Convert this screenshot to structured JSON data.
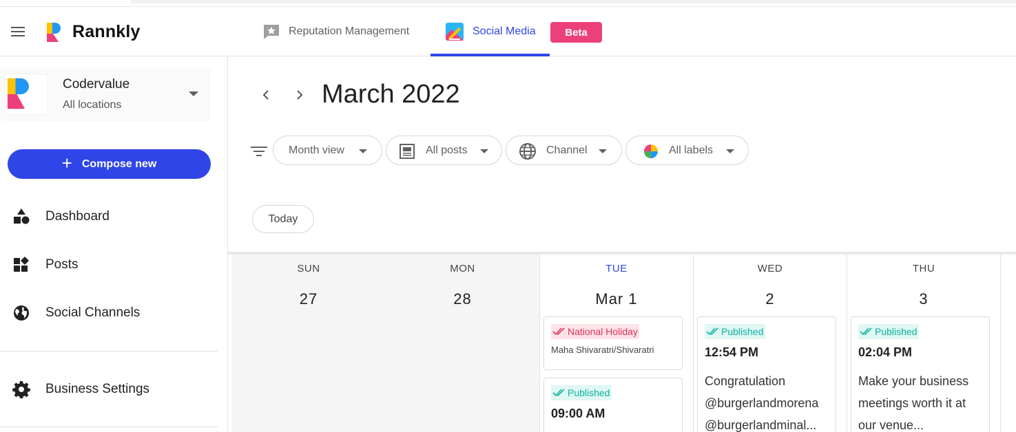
{
  "header": {
    "brand": "Rannkly",
    "tabs": [
      {
        "label": "Reputation Management",
        "icon": "star-flag-icon",
        "active": false
      },
      {
        "label": "Social Media",
        "icon": "social-media-icon",
        "active": true
      }
    ],
    "beta_label": "Beta"
  },
  "sidebar": {
    "account": {
      "name": "Codervalue",
      "sub": "All locations"
    },
    "compose_label": "Compose new",
    "items": [
      {
        "label": "Dashboard",
        "icon": "shapes-icon"
      },
      {
        "label": "Posts",
        "icon": "widgets-icon"
      },
      {
        "label": "Social Channels",
        "icon": "globe-icon"
      },
      {
        "label": "Business Settings",
        "icon": "gear-icon"
      }
    ]
  },
  "calendar": {
    "title": "March 2022",
    "filters": [
      {
        "label": "Month view",
        "icon": ""
      },
      {
        "label": "All posts",
        "icon": "article-icon"
      },
      {
        "label": "Channel",
        "icon": "globe-icon"
      },
      {
        "label": "All labels",
        "icon": "color-wheel-icon"
      }
    ],
    "today_label": "Today",
    "days": [
      {
        "dow": "SUN",
        "num": "27"
      },
      {
        "dow": "MON",
        "num": "28"
      },
      {
        "dow": "TUE",
        "num": "Mar 1"
      },
      {
        "dow": "WED",
        "num": "2"
      },
      {
        "dow": "THU",
        "num": "3"
      }
    ],
    "cards": {
      "tue": [
        {
          "status": "National Holiday",
          "sub": "Maha Shivaratri/Shivaratri"
        },
        {
          "status": "Published",
          "time": "09:00 AM"
        }
      ],
      "wed": {
        "status": "Published",
        "time": "12:54 PM",
        "text": "Congratulation @burgerlandmorena @burgerlandminal..."
      },
      "thu": {
        "status": "Published",
        "time": "02:04 PM",
        "text": "Make your business meetings worth it at our venue..."
      }
    }
  },
  "colors": {
    "primary": "#2f45e8",
    "beta": "#ec407a",
    "holiday": "#e0315a",
    "published": "#0ab39c"
  }
}
